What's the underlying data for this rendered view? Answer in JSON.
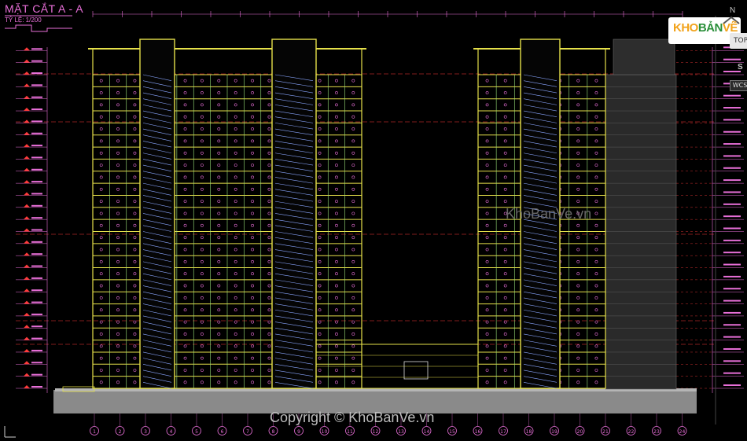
{
  "drawing": {
    "title": "MẶT CẮT A - A",
    "scale_label": "TỶ LỆ: 1/200"
  },
  "logo": {
    "kho": "KHO",
    "ban": "BẢN",
    "ve": "VẼ"
  },
  "watermark": "KhoBanVe.vn",
  "copyright": "Copyright © KhoBanVe.vn",
  "viewcube": {
    "north": "N",
    "top": "TOP",
    "south": "S",
    "wcs": "WCS"
  },
  "grid_axes": [
    "1",
    "2",
    "3",
    "4",
    "5",
    "6",
    "7",
    "8",
    "9",
    "10",
    "11",
    "12",
    "13",
    "14",
    "15",
    "16",
    "17",
    "18",
    "19",
    "20",
    "21",
    "22",
    "23",
    "24"
  ],
  "floor_count": 26,
  "colors": {
    "background": "#000000",
    "title": "#e86fd8",
    "building": "#e5e04a",
    "walls": "#9be37a",
    "dimension": "#e86fd8",
    "level_line": "#ff3b3b",
    "stair": "#8aa6ff",
    "ground": "#8a8a8a"
  }
}
